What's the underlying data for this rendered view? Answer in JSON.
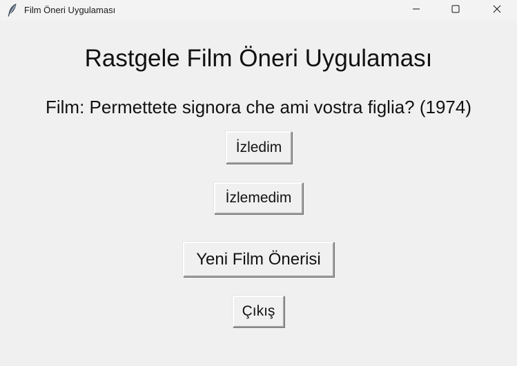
{
  "window": {
    "title": "Film Öneri Uygulaması",
    "icon": "feather-icon",
    "controls": {
      "minimize_icon": "minimize-icon",
      "maximize_icon": "maximize-icon",
      "close_icon": "close-icon"
    }
  },
  "main": {
    "heading": "Rastgele Film Öneri Uygulaması",
    "film_label": "Film: Permettete signora che ami vostra figlia? (1974)"
  },
  "buttons": {
    "watched": "İzledim",
    "not_watched": "İzlemedim",
    "new_suggestion": "Yeni Film Önerisi",
    "exit": "Çıkış"
  }
}
